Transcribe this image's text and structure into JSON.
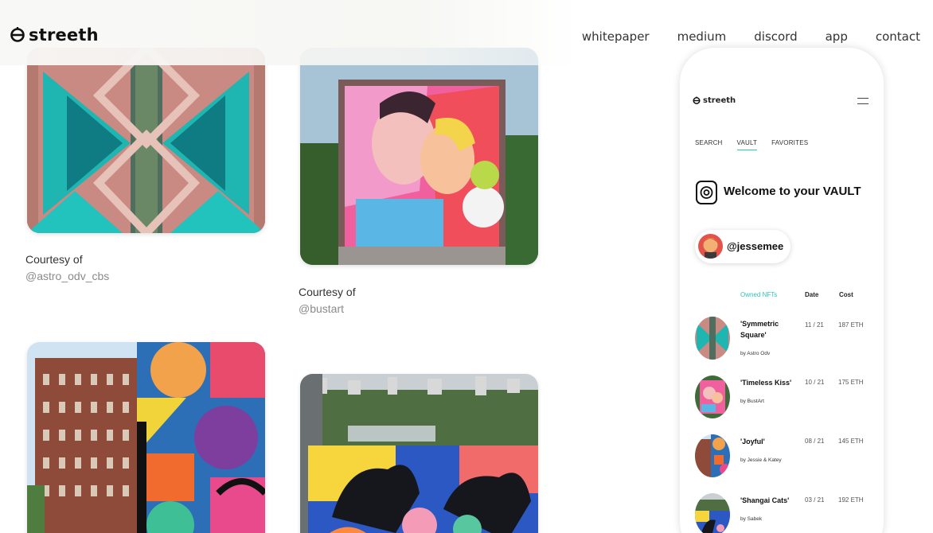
{
  "header": {
    "logo_text": "streeth",
    "nav": [
      "whitepaper",
      "medium",
      "discord",
      "app",
      "contact"
    ]
  },
  "gallery": [
    {
      "courtesy": "Courtesy of",
      "handle": "@astro_odv_cbs"
    },
    {
      "courtesy": "Courtesy of",
      "handle": "@bustart"
    }
  ],
  "phone": {
    "logo_text": "streeth",
    "tabs": [
      "SEARCH",
      "VAULT",
      "FAVORITES"
    ],
    "active_tab": "VAULT",
    "welcome": "Welcome to your VAULT",
    "user_handle": "@jessemee",
    "table_headers": {
      "nfts": "Owned NFTs",
      "date": "Date",
      "cost": "Cost"
    },
    "rows": [
      {
        "title": "'Symmetric Square'",
        "by": "by Astro Odv",
        "date": "11 / 21",
        "cost": "187 ETH"
      },
      {
        "title": "'Timeless Kiss'",
        "by": "by BustArt",
        "date": "10 / 21",
        "cost": "175 ETH"
      },
      {
        "title": "'Joyful'",
        "by": "by Jessie & Katey",
        "date": "08 / 21",
        "cost": "145 ETH"
      },
      {
        "title": "'Shangai Cats'",
        "by": "by Sabek",
        "date": "03 / 21",
        "cost": "192 ETH"
      }
    ]
  },
  "colors": {
    "accent": "#2ec4b6",
    "text": "#222222",
    "muted": "#8a8a8a"
  }
}
